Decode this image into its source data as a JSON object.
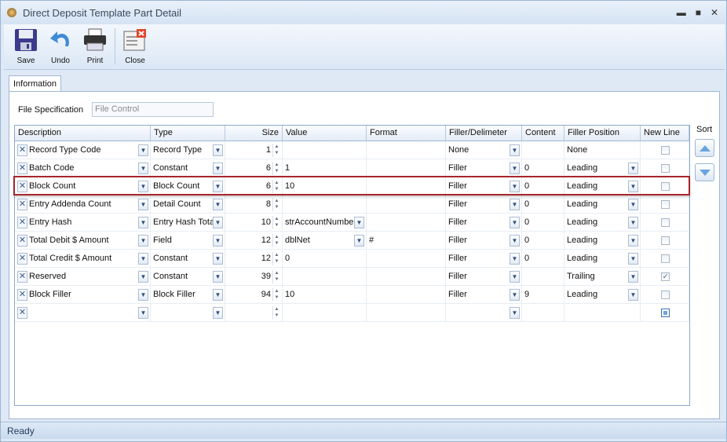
{
  "window": {
    "title": "Direct Deposit Template Part Detail",
    "min": "▬",
    "max": "■",
    "close": "✕"
  },
  "toolbar": [
    {
      "label": "Save",
      "icon": "save-icon"
    },
    {
      "label": "Undo",
      "icon": "undo-icon"
    },
    {
      "label": "Print",
      "icon": "print-icon"
    },
    {
      "label": "Close",
      "icon": "close-icon"
    }
  ],
  "tabs": [
    {
      "label": "Information"
    }
  ],
  "file_spec": {
    "label": "File Specification",
    "value": "File Control"
  },
  "grid": {
    "columns": [
      "Description",
      "Type",
      "Size",
      "Value",
      "Format",
      "Filler/Delimeter",
      "Content",
      "Filler Position",
      "New Line"
    ],
    "rows": [
      {
        "description": "Record Type Code",
        "type": "Record Type",
        "size": "1",
        "value": "",
        "value_dd": false,
        "format": "",
        "filler": "None",
        "content": "",
        "position": "None",
        "position_dd": false,
        "new_line": false
      },
      {
        "description": "Batch Code",
        "type": "Constant",
        "size": "6",
        "value": "1",
        "value_dd": false,
        "format": "",
        "filler": "Filler",
        "content": "0",
        "position": "Leading",
        "position_dd": true,
        "new_line": false
      },
      {
        "description": "Block Count",
        "type": "Block Count",
        "size": "6",
        "value": "10",
        "value_dd": false,
        "format": "",
        "filler": "Filler",
        "content": "0",
        "position": "Leading",
        "position_dd": true,
        "new_line": false,
        "selected": true
      },
      {
        "description": "Entry Addenda Count",
        "type": "Detail Count",
        "size": "8",
        "value": "",
        "value_dd": false,
        "format": "",
        "filler": "Filler",
        "content": "0",
        "position": "Leading",
        "position_dd": true,
        "new_line": false
      },
      {
        "description": "Entry Hash",
        "type": "Entry Hash Total",
        "size": "10",
        "value": "strAccountNumber",
        "value_dd": true,
        "format": "",
        "filler": "Filler",
        "content": "0",
        "position": "Leading",
        "position_dd": true,
        "new_line": false
      },
      {
        "description": "Total Debit $ Amount",
        "type": "Field",
        "size": "12",
        "value": "dblNet",
        "value_dd": true,
        "format": "#",
        "filler": "Filler",
        "content": "0",
        "position": "Leading",
        "position_dd": true,
        "new_line": false
      },
      {
        "description": "Total Credit $ Amount",
        "type": "Constant",
        "size": "12",
        "value": "0",
        "value_dd": false,
        "format": "",
        "filler": "Filler",
        "content": "0",
        "position": "Leading",
        "position_dd": true,
        "new_line": false
      },
      {
        "description": "Reserved",
        "type": "Constant",
        "size": "39",
        "value": "",
        "value_dd": false,
        "format": "",
        "filler": "Filler",
        "content": "",
        "position": "Trailing",
        "position_dd": true,
        "new_line": true
      },
      {
        "description": "Block Filler",
        "type": "Block Filler",
        "size": "94",
        "value": "10",
        "value_dd": false,
        "format": "",
        "filler": "Filler",
        "content": "9",
        "position": "Leading",
        "position_dd": true,
        "new_line": false
      },
      {
        "description": "",
        "type": "",
        "size": "",
        "value": "",
        "value_dd": false,
        "format": "",
        "filler": "",
        "content": "",
        "position": "",
        "position_dd": false,
        "new_line": "indeterminate"
      }
    ]
  },
  "sort": {
    "label": "Sort"
  },
  "status": "Ready",
  "colors": {
    "selection_border": "#a8262e",
    "header_bg": "#e4ecf6",
    "window_bg": "#dfe9f5"
  }
}
